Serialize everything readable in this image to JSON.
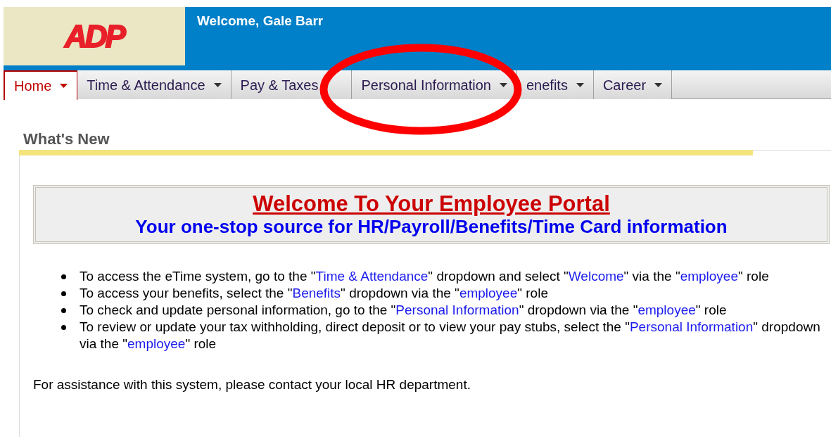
{
  "header": {
    "logo": "ADP",
    "welcome": "Welcome, Gale Barr"
  },
  "tabs": [
    {
      "label": "Home",
      "selected": true,
      "caret": true
    },
    {
      "label": "Time & Attendance",
      "selected": false,
      "caret": true
    },
    {
      "label": "Pay & Taxes",
      "selected": false,
      "caret": false
    },
    {
      "label": "Personal Information",
      "selected": false,
      "caret": true
    },
    {
      "label": "enefits",
      "selected": false,
      "caret": true
    },
    {
      "label": "Career",
      "selected": false,
      "caret": true
    }
  ],
  "annotation": {
    "kind": "ellipse",
    "color": "#ff0000"
  },
  "section_title": "What's New",
  "banner": {
    "title": "Welcome To Your Employee Portal",
    "subtitle": "Your one-stop source for HR/Payroll/Benefits/Time Card information"
  },
  "bullets": [
    [
      {
        "text": "To access the eTime system, go to the \"",
        "hl": false
      },
      {
        "text": "Time & Attendance",
        "hl": true
      },
      {
        "text": "\" dropdown and select \"",
        "hl": false
      },
      {
        "text": "Welcome",
        "hl": true
      },
      {
        "text": "\" via the \"",
        "hl": false
      },
      {
        "text": "employee",
        "hl": true
      },
      {
        "text": "\" role",
        "hl": false
      }
    ],
    [
      {
        "text": "To access your benefits, select the \"",
        "hl": false
      },
      {
        "text": "Benefits",
        "hl": true
      },
      {
        "text": "\" dropdown via the \"",
        "hl": false
      },
      {
        "text": "employee",
        "hl": true
      },
      {
        "text": "\" role",
        "hl": false
      }
    ],
    [
      {
        "text": "To check and update personal information, go to the \"",
        "hl": false
      },
      {
        "text": "Personal Information",
        "hl": true
      },
      {
        "text": "\" dropdown via the \"",
        "hl": false
      },
      {
        "text": "employee",
        "hl": true
      },
      {
        "text": "\" role",
        "hl": false
      }
    ],
    [
      {
        "text": "To review or update your tax withholding, direct deposit or to view your pay stubs, select the \"",
        "hl": false
      },
      {
        "text": "Personal Information",
        "hl": true
      },
      {
        "text": "\" dropdown via the \"",
        "hl": false
      },
      {
        "text": "employee",
        "hl": true
      },
      {
        "text": "\" role",
        "hl": false
      }
    ]
  ],
  "assistance": "For assistance with this system, please contact your local HR department."
}
